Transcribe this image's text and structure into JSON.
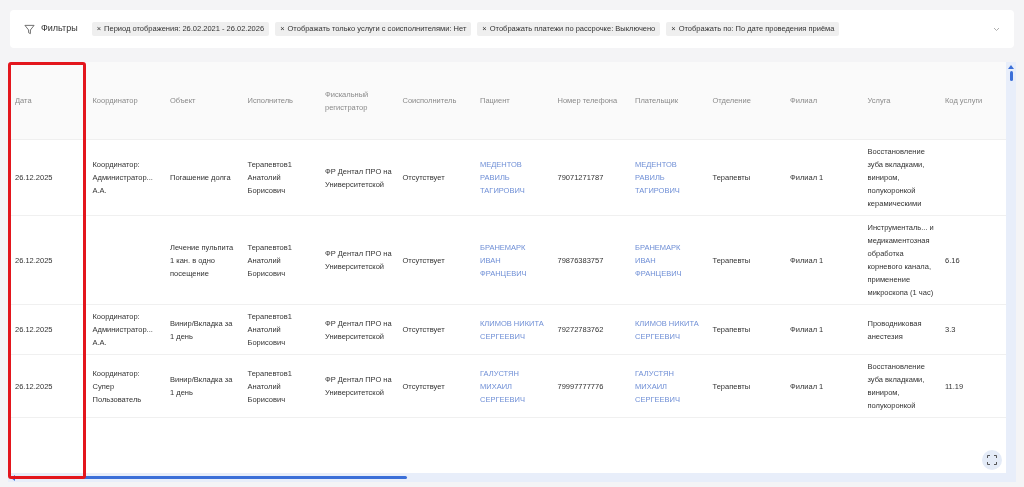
{
  "filters": {
    "label": "Фильтры",
    "chips": [
      {
        "remove": "×",
        "text": "Период отображения: 26.02.2021 - 26.02.2026"
      },
      {
        "remove": "×",
        "text": "Отображать только услуги с соисполнителями: Нет"
      },
      {
        "remove": "×",
        "text": "Отображать платежи по рассрочке: Выключено"
      },
      {
        "remove": "×",
        "text": "Отображать по: По дате проведения приёма"
      }
    ]
  },
  "table": {
    "columns": [
      {
        "label": "Дата",
        "highlighted": true
      },
      {
        "label": "Координатор",
        "highlighted": false
      },
      {
        "label": "Объект",
        "highlighted": false
      },
      {
        "label": "Исполнитель",
        "highlighted": false
      },
      {
        "label": "Фискальный регистратор",
        "highlighted": false
      },
      {
        "label": "Соисполнитель",
        "highlighted": false
      },
      {
        "label": "Пациент",
        "highlighted": false
      },
      {
        "label": "Номер телефона",
        "highlighted": false
      },
      {
        "label": "Плательщик",
        "highlighted": false
      },
      {
        "label": "Отделение",
        "highlighted": false
      },
      {
        "label": "Филиал",
        "highlighted": false
      },
      {
        "label": "Услуга",
        "highlighted": false
      },
      {
        "label": "Код услуги",
        "highlighted": false
      }
    ],
    "rows": [
      {
        "cells": [
          {
            "kind": "text",
            "text": "26.12.2025"
          },
          {
            "kind": "text",
            "text": "Координатор: Администратор... А.А."
          },
          {
            "kind": "text",
            "text": "Погашение долга"
          },
          {
            "kind": "text",
            "text": "Терапевтов1 Анатолий Борисович"
          },
          {
            "kind": "text",
            "text": "ФР Дентал ПРО на Университетской"
          },
          {
            "kind": "text",
            "text": "Отсутствует"
          },
          {
            "kind": "link",
            "text": "МЕДЕНТОВ РАВИЛЬ ТАГИРОВИЧ"
          },
          {
            "kind": "text",
            "text": "79071271787"
          },
          {
            "kind": "link",
            "text": "МЕДЕНТОВ РАВИЛЬ ТАГИРОВИЧ"
          },
          {
            "kind": "text",
            "text": "Терапевты"
          },
          {
            "kind": "text",
            "text": "Филиал 1"
          },
          {
            "kind": "text",
            "text": "Восстановление зуба вкладками, виниром, полукоронкой керамическими"
          },
          {
            "kind": "empty"
          }
        ]
      },
      {
        "cells": [
          {
            "kind": "text",
            "text": "26.12.2025"
          },
          {
            "kind": "empty"
          },
          {
            "kind": "text",
            "text": "Лечение пульпита 1 кан. в одно посещение"
          },
          {
            "kind": "text",
            "text": "Терапевтов1 Анатолий Борисович"
          },
          {
            "kind": "text",
            "text": "ФР Дентал ПРО на Университетской"
          },
          {
            "kind": "text",
            "text": "Отсутствует"
          },
          {
            "kind": "link",
            "text": "БРАНЕМАРК ИВАН ФРАНЦЕВИЧ"
          },
          {
            "kind": "text",
            "text": "79876383757"
          },
          {
            "kind": "link",
            "text": "БРАНЕМАРК ИВАН ФРАНЦЕВИЧ"
          },
          {
            "kind": "text",
            "text": "Терапевты"
          },
          {
            "kind": "text",
            "text": "Филиал 1"
          },
          {
            "kind": "text",
            "text": "Инструменталь... и медикаментозная обработка корневого канала, применение микроскопа (1 час)"
          },
          {
            "kind": "text",
            "text": "6.16"
          }
        ]
      },
      {
        "cells": [
          {
            "kind": "text",
            "text": "26.12.2025"
          },
          {
            "kind": "text",
            "text": "Координатор: Администратор... А.А."
          },
          {
            "kind": "text",
            "text": "Винир/Вкладка за 1 день"
          },
          {
            "kind": "text",
            "text": "Терапевтов1 Анатолий Борисович"
          },
          {
            "kind": "text",
            "text": "ФР Дентал ПРО на Университетской"
          },
          {
            "kind": "text",
            "text": "Отсутствует"
          },
          {
            "kind": "link",
            "text": "КЛИМОВ НИКИТА СЕРГЕЕВИЧ"
          },
          {
            "kind": "text",
            "text": "79272783762"
          },
          {
            "kind": "link",
            "text": "КЛИМОВ НИКИТА СЕРГЕЕВИЧ"
          },
          {
            "kind": "text",
            "text": "Терапевты"
          },
          {
            "kind": "text",
            "text": "Филиал 1"
          },
          {
            "kind": "text",
            "text": "Проводниковая анестезия"
          },
          {
            "kind": "text",
            "text": "3.3"
          }
        ]
      },
      {
        "cells": [
          {
            "kind": "text",
            "text": "26.12.2025"
          },
          {
            "kind": "text",
            "text": "Координатор: Супер Пользователь"
          },
          {
            "kind": "text",
            "text": "Винир/Вкладка за 1 день"
          },
          {
            "kind": "text",
            "text": "Терапевтов1 Анатолий Борисович"
          },
          {
            "kind": "text",
            "text": "ФР Дентал ПРО на Университетской"
          },
          {
            "kind": "text",
            "text": "Отсутствует"
          },
          {
            "kind": "link",
            "text": "ГАЛУСТЯН МИХАИЛ СЕРГЕЕВИЧ"
          },
          {
            "kind": "text",
            "text": "79997777776"
          },
          {
            "kind": "link",
            "text": "ГАЛУСТЯН МИХАИЛ СЕРГЕЕВИЧ"
          },
          {
            "kind": "text",
            "text": "Терапевты"
          },
          {
            "kind": "text",
            "text": "Филиал 1"
          },
          {
            "kind": "text",
            "text": "Восстановление зуба вкладками, виниром, полукоронкой"
          },
          {
            "kind": "text",
            "text": "11.19"
          }
        ]
      }
    ]
  }
}
